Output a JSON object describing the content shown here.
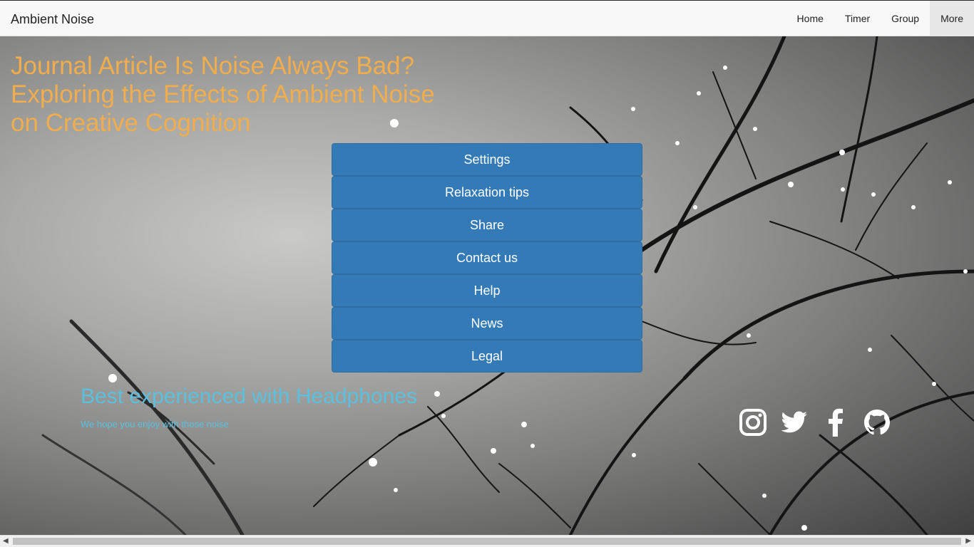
{
  "navbar": {
    "brand": "Ambient Noise",
    "items": [
      {
        "label": "Home"
      },
      {
        "label": "Timer"
      },
      {
        "label": "Group"
      },
      {
        "label": "More"
      }
    ]
  },
  "hero": {
    "headline": "Journal Article Is Noise Always Bad? Exploring the Effects of Ambient Noise on Creative Cognition",
    "menu": [
      {
        "label": "Settings"
      },
      {
        "label": "Relaxation tips"
      },
      {
        "label": "Share"
      },
      {
        "label": "Contact us"
      },
      {
        "label": "Help"
      },
      {
        "label": "News"
      },
      {
        "label": "Legal"
      }
    ],
    "tagline": "Best experienced with Headphones",
    "subtagline": "We hope you enjoy with those noise",
    "social_icons": [
      "instagram-icon",
      "twitter-icon",
      "facebook-icon",
      "github-icon"
    ]
  },
  "colors": {
    "headline": "#f0ad4e",
    "button": "#337ab7",
    "tagline": "#5bc0de"
  }
}
